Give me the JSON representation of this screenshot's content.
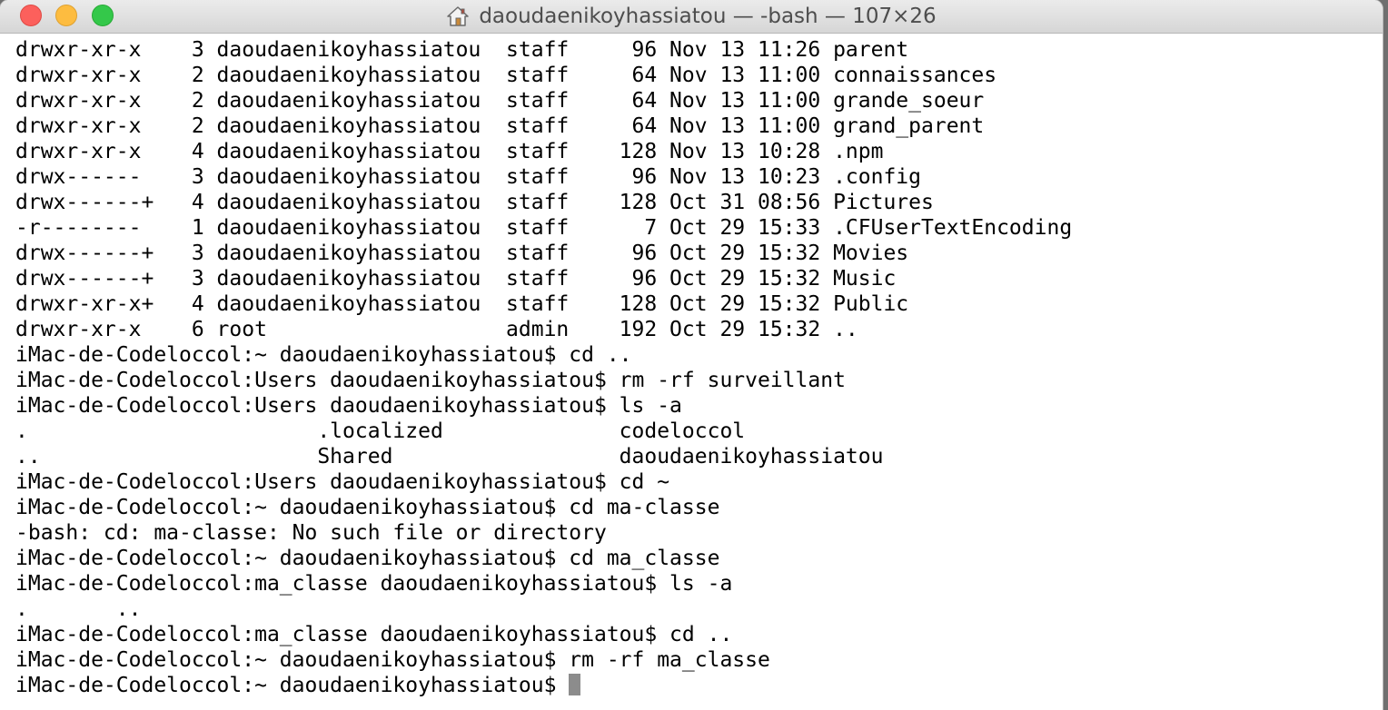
{
  "window": {
    "title": "daoudaenikoyhassiatou — -bash — 107×26"
  },
  "terminal": {
    "lines": [
      "drwxr-xr-x    3 daoudaenikoyhassiatou  staff     96 Nov 13 11:26 parent",
      "drwxr-xr-x    2 daoudaenikoyhassiatou  staff     64 Nov 13 11:00 connaissances",
      "drwxr-xr-x    2 daoudaenikoyhassiatou  staff     64 Nov 13 11:00 grande_soeur",
      "drwxr-xr-x    2 daoudaenikoyhassiatou  staff     64 Nov 13 11:00 grand_parent",
      "drwxr-xr-x    4 daoudaenikoyhassiatou  staff    128 Nov 13 10:28 .npm",
      "drwx------    3 daoudaenikoyhassiatou  staff     96 Nov 13 10:23 .config",
      "drwx------+   4 daoudaenikoyhassiatou  staff    128 Oct 31 08:56 Pictures",
      "-r--------    1 daoudaenikoyhassiatou  staff      7 Oct 29 15:33 .CFUserTextEncoding",
      "drwx------+   3 daoudaenikoyhassiatou  staff     96 Oct 29 15:32 Movies",
      "drwx------+   3 daoudaenikoyhassiatou  staff     96 Oct 29 15:32 Music",
      "drwxr-xr-x+   4 daoudaenikoyhassiatou  staff    128 Oct 29 15:32 Public",
      "drwxr-xr-x    6 root                   admin    192 Oct 29 15:32 ..",
      "iMac-de-Codeloccol:~ daoudaenikoyhassiatou$ cd ..",
      "iMac-de-Codeloccol:Users daoudaenikoyhassiatou$ rm -rf surveillant",
      "iMac-de-Codeloccol:Users daoudaenikoyhassiatou$ ls -a",
      ".                       .localized              codeloccol",
      "..                      Shared                  daoudaenikoyhassiatou",
      "iMac-de-Codeloccol:Users daoudaenikoyhassiatou$ cd ~",
      "iMac-de-Codeloccol:~ daoudaenikoyhassiatou$ cd ma-classe",
      "-bash: cd: ma-classe: No such file or directory",
      "iMac-de-Codeloccol:~ daoudaenikoyhassiatou$ cd ma_classe",
      "iMac-de-Codeloccol:ma_classe daoudaenikoyhassiatou$ ls -a",
      ".       ..",
      "iMac-de-Codeloccol:ma_classe daoudaenikoyhassiatou$ cd ..",
      "iMac-de-Codeloccol:~ daoudaenikoyhassiatou$ rm -rf ma_classe",
      "iMac-de-Codeloccol:~ daoudaenikoyhassiatou$ "
    ]
  }
}
